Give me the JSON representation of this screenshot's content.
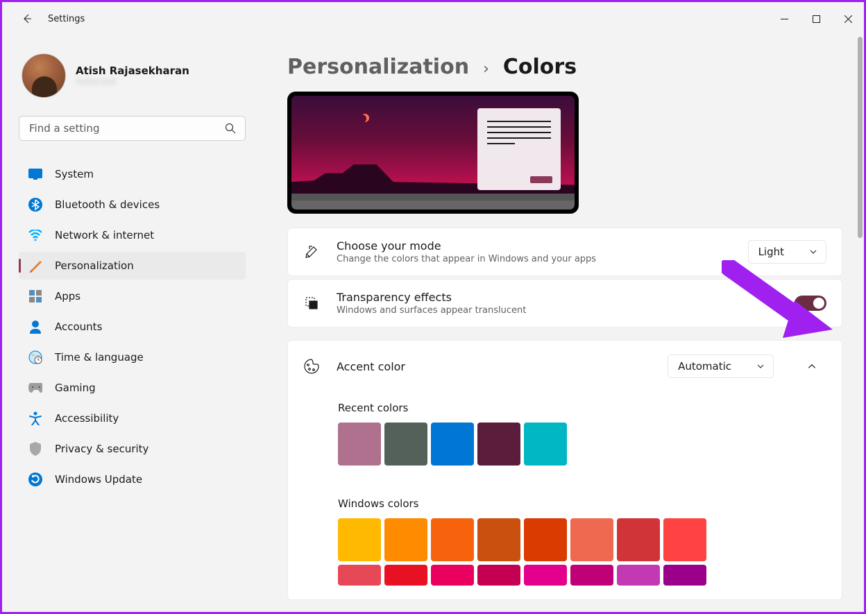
{
  "app": {
    "title": "Settings"
  },
  "user": {
    "name": "Atish Rajasekharan",
    "email": "redacted"
  },
  "search": {
    "placeholder": "Find a setting"
  },
  "sidebar": {
    "items": [
      {
        "label": "System"
      },
      {
        "label": "Bluetooth & devices"
      },
      {
        "label": "Network & internet"
      },
      {
        "label": "Personalization"
      },
      {
        "label": "Apps"
      },
      {
        "label": "Accounts"
      },
      {
        "label": "Time & language"
      },
      {
        "label": "Gaming"
      },
      {
        "label": "Accessibility"
      },
      {
        "label": "Privacy & security"
      },
      {
        "label": "Windows Update"
      }
    ]
  },
  "breadcrumb": {
    "parent": "Personalization",
    "current": "Colors"
  },
  "cards": {
    "mode": {
      "title": "Choose your mode",
      "sub": "Change the colors that appear in Windows and your apps",
      "value": "Light"
    },
    "transparency": {
      "title": "Transparency effects",
      "sub": "Windows and surfaces appear translucent",
      "state": "On"
    },
    "accent": {
      "title": "Accent color",
      "value": "Automatic",
      "recent_label": "Recent colors",
      "recent_colors": [
        "#b0718f",
        "#53615a",
        "#0077d4",
        "#5c1d3d",
        "#00b7c3"
      ],
      "windows_label": "Windows colors",
      "windows_colors_row1": [
        "#ffb900",
        "#ff8c00",
        "#f7630c",
        "#ca5010",
        "#da3b01",
        "#ef6950",
        "#d13438",
        "#ff4343"
      ],
      "windows_colors_row2": [
        "#e74856",
        "#e81123",
        "#ea005e",
        "#c30052",
        "#e3008c",
        "#bf0077",
        "#c239b3",
        "#9a0089"
      ]
    }
  }
}
